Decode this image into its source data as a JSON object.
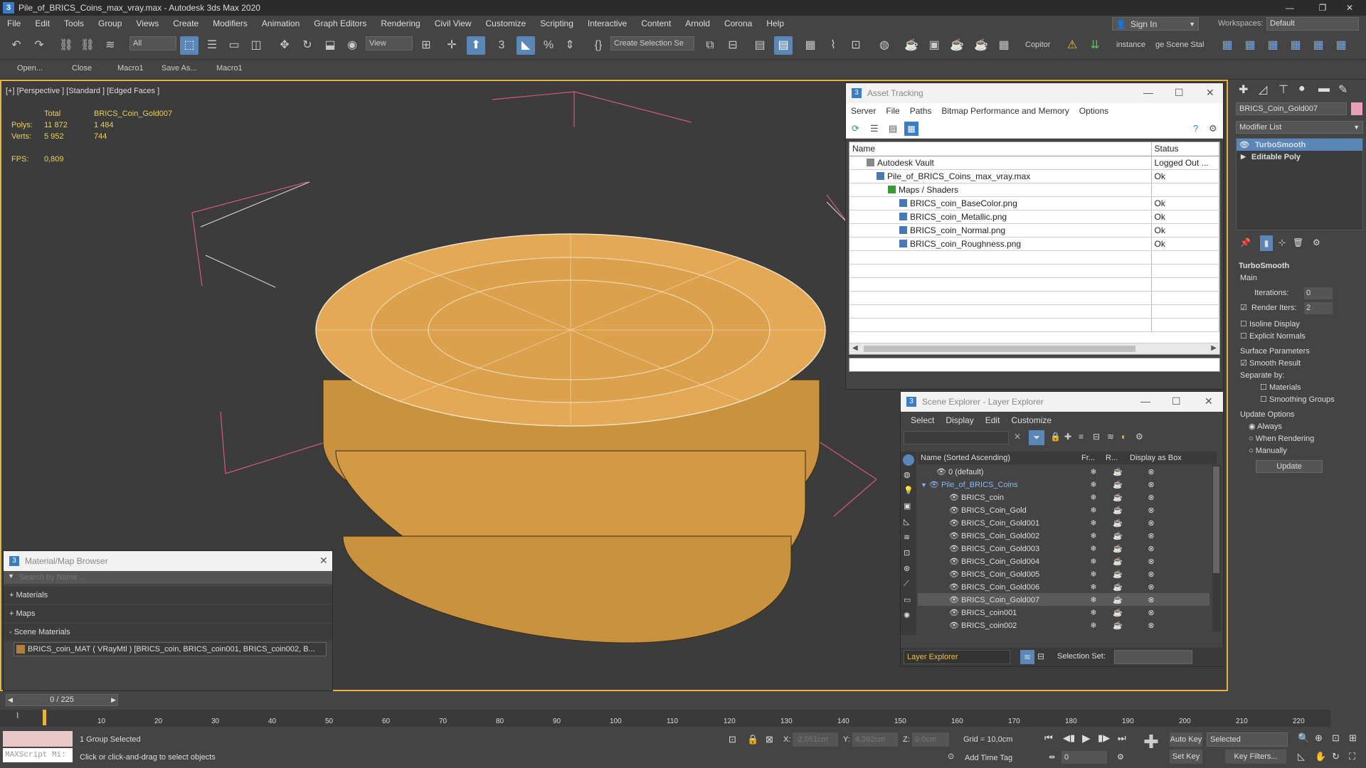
{
  "window": {
    "title": "Pile_of_BRICS_Coins_max_vray.max - Autodesk 3ds Max 2020",
    "minimize": "—",
    "maximize": "❐",
    "close": "✕"
  },
  "menu": [
    "File",
    "Edit",
    "Tools",
    "Group",
    "Views",
    "Create",
    "Modifiers",
    "Animation",
    "Graph Editors",
    "Rendering",
    "Civil View",
    "Customize",
    "Scripting",
    "Interactive",
    "Content",
    "Arnold",
    "Corona",
    "Help"
  ],
  "account": {
    "sign_in": "Sign In",
    "workspaces_label": "Workspaces:",
    "workspace": "Default"
  },
  "toolbar": {
    "filter": "All",
    "ref_coord": "View",
    "selection_set": "Create Selection Se",
    "copitor": "Copitor",
    "instance": "instance",
    "scene_stat": "ge Scene Stal"
  },
  "toolbar2": [
    "Open...",
    "Close",
    "Macro1",
    "Save As...",
    "Macro1"
  ],
  "viewport": {
    "label": "[+] [Perspective ] [Standard ] [Edged Faces ]",
    "stats": {
      "total_label": "Total",
      "object_name": "BRICS_Coin_Gold007",
      "polys_label": "Polys:",
      "polys_total": "11 872",
      "polys_obj": "1 484",
      "verts_label": "Verts:",
      "verts_total": "5 952",
      "verts_obj": "744",
      "fps_label": "FPS:",
      "fps_value": "0,809"
    }
  },
  "asset_tracking": {
    "title": "Asset Tracking",
    "menu": [
      "Server",
      "File",
      "Paths",
      "Bitmap Performance and Memory",
      "Options"
    ],
    "columns": [
      "Name",
      "Status"
    ],
    "rows": [
      {
        "name": "Autodesk Vault",
        "status": "Logged Out ..."
      },
      {
        "name": "Pile_of_BRICS_Coins_max_vray.max",
        "status": "Ok"
      },
      {
        "name": "Maps / Shaders",
        "status": ""
      },
      {
        "name": "BRICS_coin_BaseColor.png",
        "status": "Ok"
      },
      {
        "name": "BRICS_coin_Metallic.png",
        "status": "Ok"
      },
      {
        "name": "BRICS_coin_Normal.png",
        "status": "Ok"
      },
      {
        "name": "BRICS_coin_Roughness.png",
        "status": "Ok"
      }
    ]
  },
  "layer_explorer": {
    "title": "Scene Explorer - Layer Explorer",
    "menu": [
      "Select",
      "Display",
      "Edit",
      "Customize"
    ],
    "columns": [
      "Name (Sorted Ascending)",
      "Fr...",
      "R...",
      "Display as Box"
    ],
    "rows": [
      "0 (default)",
      "Pile_of_BRICS_Coins",
      "BRICS_coin",
      "BRICS_Coin_Gold",
      "BRICS_Coin_Gold001",
      "BRICS_Coin_Gold002",
      "BRICS_Coin_Gold003",
      "BRICS_Coin_Gold004",
      "BRICS_Coin_Gold005",
      "BRICS_Coin_Gold006",
      "BRICS_Coin_Gold007",
      "BRICS_coin001",
      "BRICS_coin002"
    ],
    "footer_label": "Layer Explorer",
    "selection_set_label": "Selection Set:"
  },
  "material_browser": {
    "title": "Material/Map Browser",
    "search_placeholder": "Search by Name ...",
    "groups": [
      "+ Materials",
      "+ Maps",
      "- Scene Materials"
    ],
    "scene_material": "BRICS_coin_MAT  ( VRayMtl ) [BRICS_coin, BRICS_coin001, BRICS_coin002, B..."
  },
  "command_panel": {
    "object_name": "BRICS_Coin_Gold007",
    "modifier_list": "Modifier List",
    "stack": [
      "TurboSmooth",
      "Editable Poly"
    ],
    "rollout_title": "TurboSmooth",
    "main_label": "Main",
    "iterations_label": "Iterations:",
    "iterations_value": "0",
    "render_iters_label": "Render Iters:",
    "render_iters_value": "2",
    "isoline": "Isoline Display",
    "explicit_normals": "Explicit Normals",
    "surface_params": "Surface Parameters",
    "smooth_result": "Smooth Result",
    "separate_by": "Separate by:",
    "materials": "Materials",
    "smoothing_groups": "Smoothing Groups",
    "update_options": "Update Options",
    "always": "Always",
    "when_rendering": "When Rendering",
    "manually": "Manually",
    "update_button": "Update"
  },
  "timeline": {
    "frame_counter": "0 / 225",
    "ticks": [
      "10",
      "20",
      "30",
      "40",
      "50",
      "60",
      "70",
      "80",
      "90",
      "100",
      "110",
      "120",
      "130",
      "140",
      "150",
      "160",
      "170",
      "180",
      "190",
      "200",
      "210",
      "220"
    ]
  },
  "status": {
    "script_placeholder": "MAXScript Mi:",
    "selection": "1 Group Selected",
    "prompt": "Click or click-and-drag to select objects",
    "x_label": "X:",
    "x_value": "-2,051cm",
    "y_label": "Y:",
    "y_value": "4,392cm",
    "z_label": "Z:",
    "z_value": "0,0cm",
    "grid": "Grid = 10,0cm",
    "add_time_tag": "Add Time Tag",
    "auto_key": "Auto Key",
    "selected": "Selected",
    "set_key": "Set Key",
    "key_filters": "Key Filters...",
    "frame": "0"
  }
}
